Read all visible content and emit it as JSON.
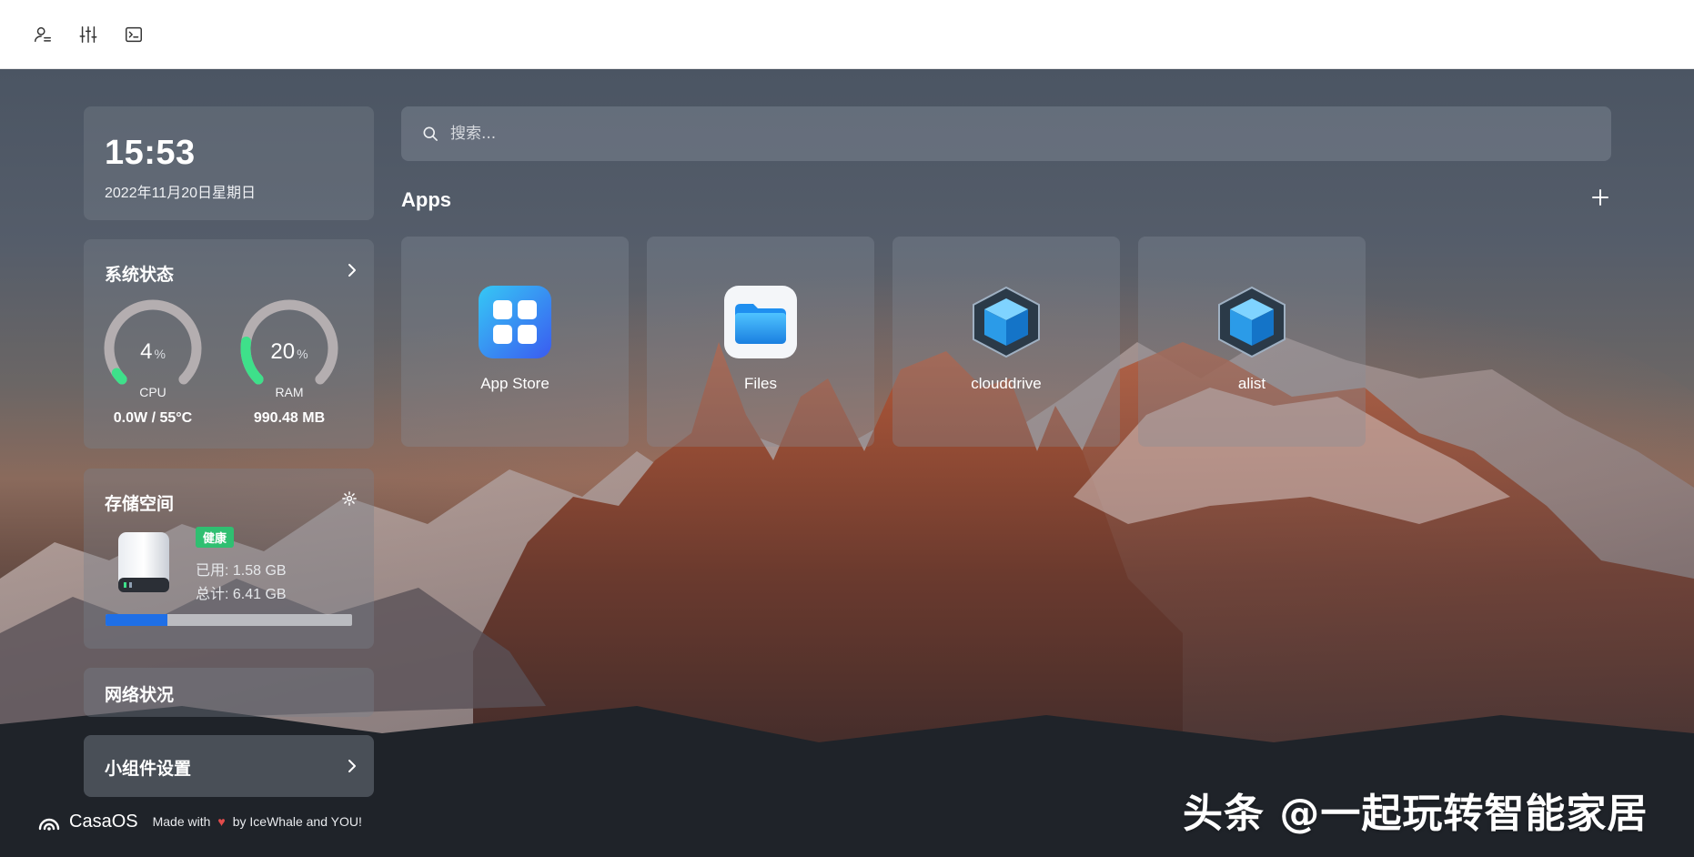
{
  "topbar": {
    "icons": [
      "user-icon",
      "sliders-icon",
      "terminal-icon"
    ]
  },
  "clock": {
    "time": "15:53",
    "date": "2022年11月20日星期日"
  },
  "system_status": {
    "title": "系统状态",
    "cpu": {
      "percent": 4,
      "value_text": "4",
      "unit": "%",
      "label": "CPU",
      "detail": "0.0W / 55°C"
    },
    "ram": {
      "percent": 20,
      "value_text": "20",
      "unit": "%",
      "label": "RAM",
      "detail": "990.48 MB"
    },
    "gauge_colors": {
      "track": "#b4aeb0",
      "fill": "#3ee08a"
    }
  },
  "storage": {
    "title": "存储空间",
    "health_badge": "健康",
    "used": "已用: 1.58 GB",
    "total": "总计: 6.41 GB",
    "used_fraction": 0.25,
    "bar_color": "#1f6fe6",
    "badge_color": "#2fbf71"
  },
  "network": {
    "title": "网络状况"
  },
  "widgets": {
    "title": "小组件设置"
  },
  "footer": {
    "brand": "CasaOS",
    "made_with": "Made with",
    "by": "by IceWhale and YOU!"
  },
  "search": {
    "placeholder": "搜索..."
  },
  "apps": {
    "title": "Apps",
    "items": [
      {
        "name": "App Store",
        "icon": "app-store-icon"
      },
      {
        "name": "Files",
        "icon": "files-icon"
      },
      {
        "name": "clouddrive",
        "icon": "cube-icon"
      },
      {
        "name": "alist",
        "icon": "cube-icon"
      }
    ]
  },
  "watermark": "头条 @一起玩转智能家居"
}
